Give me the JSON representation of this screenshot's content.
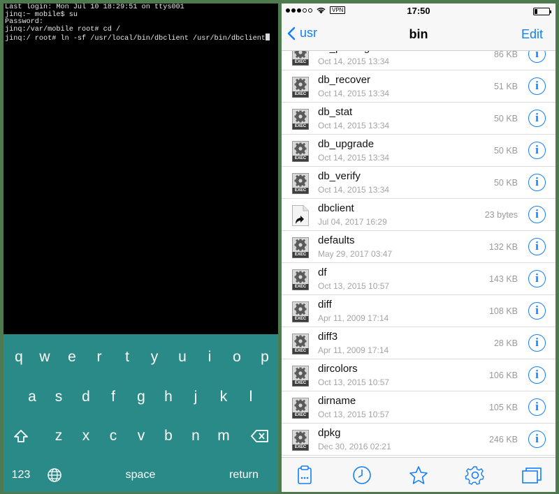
{
  "terminal": {
    "lines": [
      "Last login: Mon Jul 10 18:29:51 on ttys001",
      "jinq:~ mobile$ su",
      "Password:",
      "jinq:/var/mobile root# cd /",
      "jinq:/ root# ln -sf /usr/local/bin/dbclient /usr/bin/dbclient"
    ]
  },
  "keyboard": {
    "row1": [
      "q",
      "w",
      "e",
      "r",
      "t",
      "y",
      "u",
      "i",
      "o",
      "p"
    ],
    "row2": [
      "a",
      "s",
      "d",
      "f",
      "g",
      "h",
      "j",
      "k",
      "l"
    ],
    "row3": [
      "z",
      "x",
      "c",
      "v",
      "b",
      "n",
      "m"
    ],
    "numbers_label": "123",
    "space_label": "space",
    "return_label": "return",
    "color": "#2a8a88"
  },
  "statusbar": {
    "carrier_vpn": "VPN",
    "time": "17:50"
  },
  "nav": {
    "back_label": "usr",
    "title": "bin",
    "edit_label": "Edit",
    "accent": "#147efb"
  },
  "files": [
    {
      "name": "db_printlog",
      "date": "Oct 14, 2015 13:34",
      "size": "86 KB",
      "icon": "exec-gear-icon"
    },
    {
      "name": "db_recover",
      "date": "Oct 14, 2015 13:34",
      "size": "51 KB",
      "icon": "exec-gear-icon"
    },
    {
      "name": "db_stat",
      "date": "Oct 14, 2015 13:34",
      "size": "50 KB",
      "icon": "exec-gear-icon"
    },
    {
      "name": "db_upgrade",
      "date": "Oct 14, 2015 13:34",
      "size": "50 KB",
      "icon": "exec-gear-icon"
    },
    {
      "name": "db_verify",
      "date": "Oct 14, 2015 13:34",
      "size": "50 KB",
      "icon": "exec-gear-icon"
    },
    {
      "name": "dbclient",
      "date": "Jul 04, 2017 16:29",
      "size": "23 bytes",
      "icon": "symlink-file-icon"
    },
    {
      "name": "defaults",
      "date": "May 29, 2017 03:47",
      "size": "132 KB",
      "icon": "exec-gear-icon"
    },
    {
      "name": "df",
      "date": "Oct 13, 2015 10:57",
      "size": "143 KB",
      "icon": "exec-gear-icon"
    },
    {
      "name": "diff",
      "date": "Apr 11, 2009 17:14",
      "size": "108 KB",
      "icon": "exec-gear-icon"
    },
    {
      "name": "diff3",
      "date": "Apr 11, 2009 17:14",
      "size": "28 KB",
      "icon": "exec-gear-icon"
    },
    {
      "name": "dircolors",
      "date": "Oct 13, 2015 10:57",
      "size": "106 KB",
      "icon": "exec-gear-icon"
    },
    {
      "name": "dirname",
      "date": "Oct 13, 2015 10:57",
      "size": "105 KB",
      "icon": "exec-gear-icon"
    },
    {
      "name": "dpkg",
      "date": "Dec 30, 2016 02:21",
      "size": "246 KB",
      "icon": "exec-gear-icon"
    }
  ],
  "exec_badge": "EXEC",
  "info_glyph": "i",
  "toolbar": [
    "clipboard-icon",
    "clock-icon",
    "star-icon",
    "gear-icon",
    "windows-icon"
  ]
}
